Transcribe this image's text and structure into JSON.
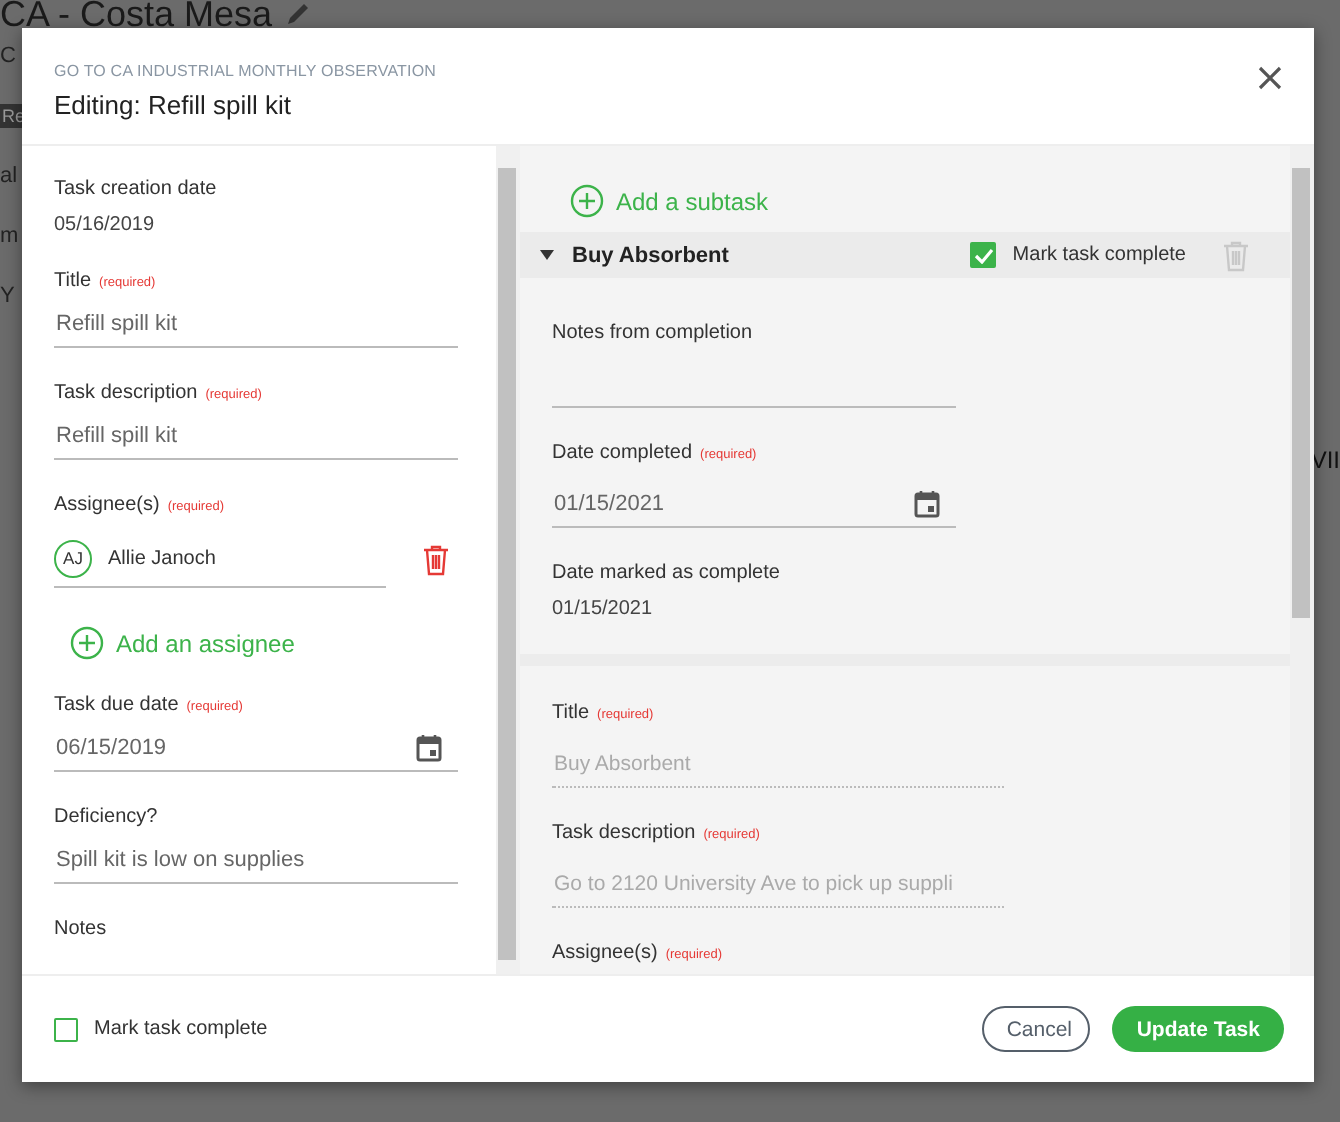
{
  "background": {
    "title": "CA - Costa Mesa",
    "left_fragments": [
      {
        "kind": "text",
        "text": "C"
      },
      {
        "kind": "tag",
        "text": "Re"
      },
      {
        "kind": "text",
        "text": "al"
      },
      {
        "kind": "text",
        "text": "m"
      },
      {
        "kind": "text",
        "text": "Y"
      }
    ],
    "right_fragment": "VII"
  },
  "modal": {
    "eyebrow": "GO TO CA INDUSTRIAL MONTHLY OBSERVATION",
    "title": "Editing: Refill spill kit"
  },
  "left_fields": [
    {
      "kind": "readonly",
      "label": "Task creation date",
      "value": "05/16/2019"
    },
    {
      "kind": "text",
      "label": "Title",
      "required_note": "(required)",
      "value": "Refill spill kit"
    },
    {
      "kind": "text",
      "label": "Task description",
      "required_note": "(required)",
      "value": "Refill spill kit"
    },
    {
      "kind": "assignees",
      "label": "Assignee(s)",
      "required_note": "(required)",
      "assignees": [
        {
          "initials": "AJ",
          "name": "Allie Janoch"
        }
      ],
      "add_label": "Add an assignee"
    },
    {
      "kind": "date",
      "label": "Task due date",
      "required_note": "(required)",
      "value": "06/15/2019"
    },
    {
      "kind": "text",
      "label": "Deficiency?",
      "value": "Spill kit is low on supplies"
    },
    {
      "kind": "label",
      "label": "Notes"
    }
  ],
  "subtasks": {
    "add_label": "Add a subtask",
    "items": [
      {
        "title": "Buy Absorbent",
        "expanded": true,
        "complete_label": "Mark task complete",
        "complete": true,
        "completion_fields": [
          {
            "kind": "text",
            "label": "Notes from completion"
          },
          {
            "kind": "date",
            "label": "Date completed",
            "required_note": "(required)",
            "value": "01/15/2021"
          },
          {
            "kind": "readonly",
            "label": "Date marked as complete",
            "value": "01/15/2021"
          }
        ],
        "detail_fields": [
          {
            "kind": "text",
            "disabled": true,
            "label": "Title",
            "required_note": "(required)",
            "value": "Buy Absorbent"
          },
          {
            "kind": "text",
            "disabled": true,
            "label": "Task description",
            "required_note": "(required)",
            "value": "Go to 2120 University Ave to pick up suppli"
          },
          {
            "kind": "label",
            "label": "Assignee(s)",
            "required_note": "(required)"
          }
        ]
      }
    ]
  },
  "footer": {
    "complete_label": "Mark task complete",
    "complete": false,
    "buttons": [
      {
        "kind": "secondary",
        "label": "Cancel"
      },
      {
        "kind": "primary",
        "label": "Update Task"
      }
    ]
  }
}
